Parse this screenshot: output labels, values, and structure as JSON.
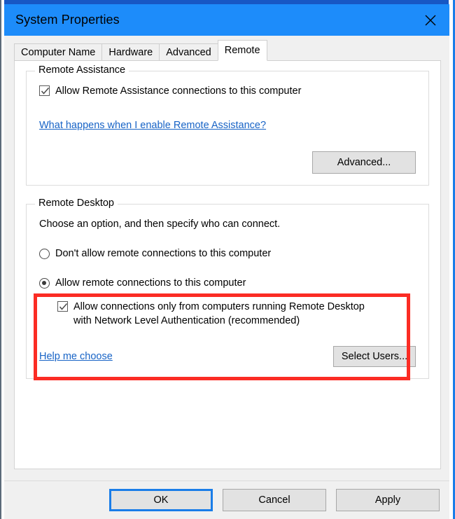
{
  "window": {
    "title": "System Properties",
    "close_icon": "close-icon",
    "titlebar_color": "#1d8cfa"
  },
  "tabs": [
    {
      "label": "Computer Name",
      "active": false
    },
    {
      "label": "Hardware",
      "active": false
    },
    {
      "label": "Advanced",
      "active": false
    },
    {
      "label": "Remote",
      "active": true
    }
  ],
  "remote_assistance": {
    "legend": "Remote Assistance",
    "allow_checkbox": {
      "label": "Allow Remote Assistance connections to this computer",
      "checked": true
    },
    "help_link": "What happens when I enable Remote Assistance?",
    "advanced_button": "Advanced..."
  },
  "remote_desktop": {
    "legend": "Remote Desktop",
    "intro": "Choose an option, and then specify who can connect.",
    "options": [
      {
        "label": "Don't allow remote connections to this computer",
        "selected": false
      },
      {
        "label": "Allow remote connections to this computer",
        "selected": true
      }
    ],
    "nla_checkbox": {
      "label": "Allow connections only from computers running Remote Desktop with Network Level Authentication (recommended)",
      "checked": true
    },
    "help_link": "Help me choose",
    "select_users_button": "Select Users..."
  },
  "footer": {
    "ok": "OK",
    "cancel": "Cancel",
    "apply": "Apply"
  },
  "annotation": {
    "highlight_color": "#fb2c24"
  }
}
